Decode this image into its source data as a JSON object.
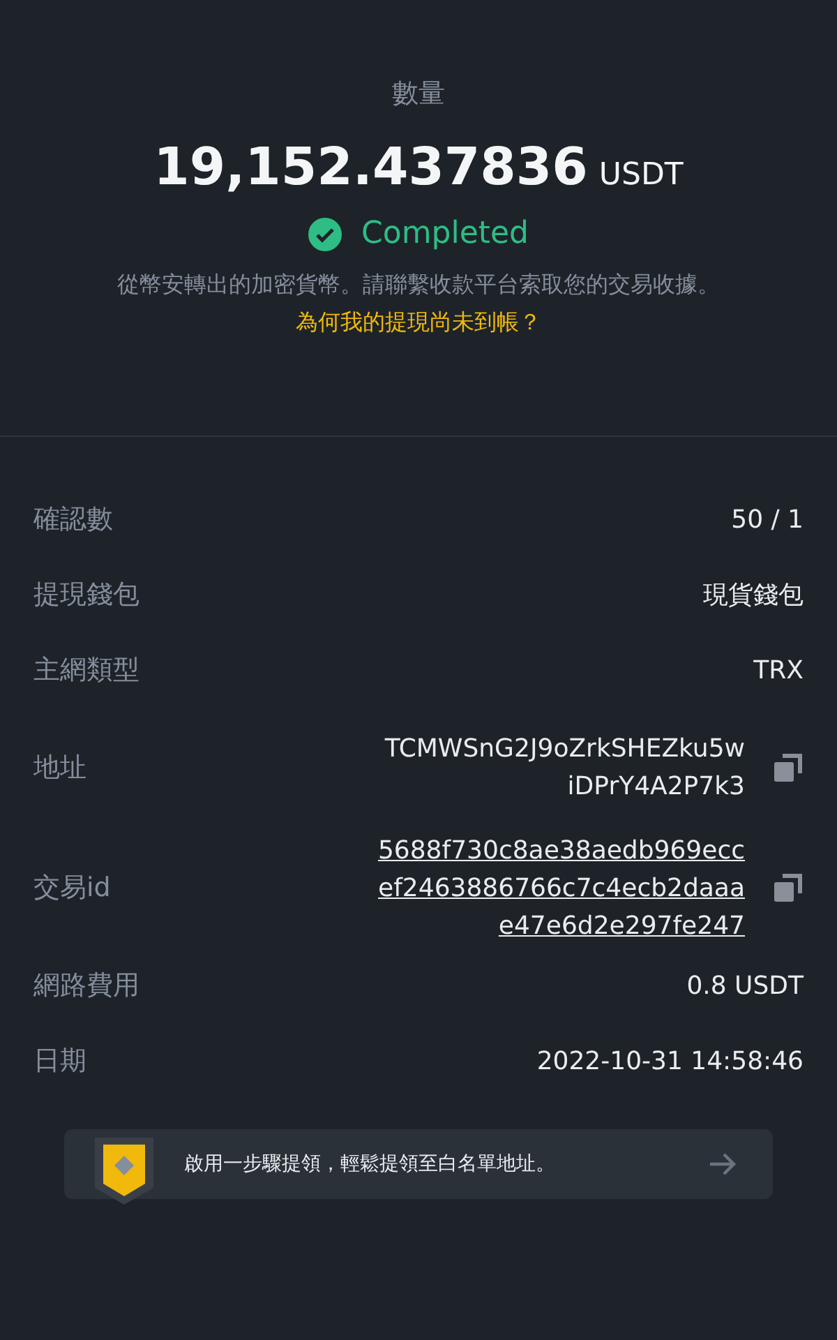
{
  "header": {
    "label": "數量",
    "amount": "19,152.437836",
    "unit": "USDT",
    "status": {
      "kind": "completed",
      "text": "Completed"
    },
    "notice": "從幣安轉出的加密貨幣。請聯繫收款平台索取您的交易收據。",
    "help_link": "為何我的提現尚未到帳？"
  },
  "details": [
    {
      "kind": "text",
      "label": "確認數",
      "value": [
        "50 / 1"
      ]
    },
    {
      "kind": "text",
      "label": "提現錢包",
      "value": [
        "現貨錢包"
      ]
    },
    {
      "kind": "text",
      "label": "主網類型",
      "value": [
        "TRX"
      ]
    },
    {
      "kind": "copy",
      "label": "地址",
      "value": [
        "TCMWSnG2J9oZrkSHEZku5w",
        "iDPrY4A2P7k3"
      ]
    },
    {
      "kind": "link",
      "label": "交易id",
      "value": [
        "5688f730c8ae38aedb969ecc",
        "ef2463886766c7c4ecb2daaa",
        "e47e6d2e297fe247"
      ]
    },
    {
      "kind": "text",
      "label": "網路費用",
      "value": [
        "0.8 USDT"
      ]
    },
    {
      "kind": "text",
      "label": "日期",
      "value": [
        "2022-10-31 14:58:46"
      ]
    }
  ],
  "banner": {
    "text": "啟用一步驟提領，輕鬆提領至白名單地址。"
  }
}
